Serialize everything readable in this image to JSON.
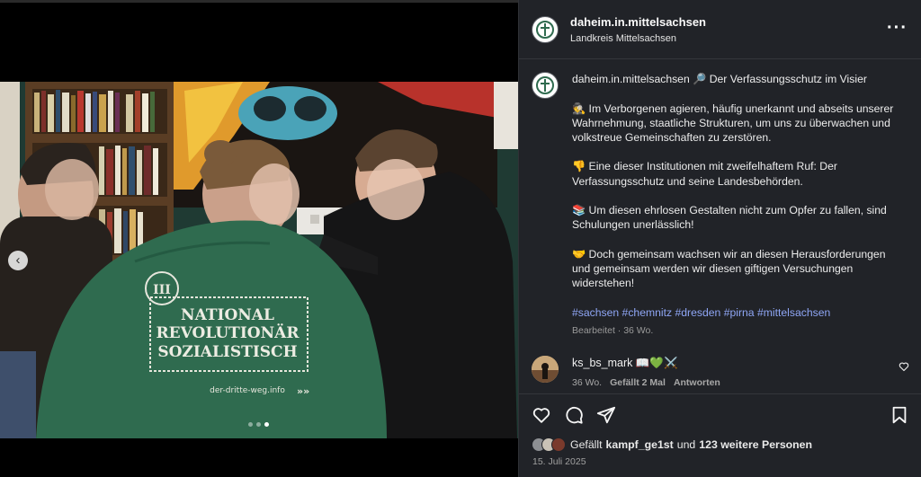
{
  "header": {
    "username": "daheim.in.mittelsachsen",
    "location": "Landkreis Mittelsachsen",
    "more_icon": "more-horizontal-icon"
  },
  "caption": {
    "owner": "daheim.in.mittelsachsen",
    "title_line": "🔎 Der Verfassungsschutz im Visier",
    "paragraphs": [
      "🕵️ Im Verborgenen agieren, häufig unerkannt und abseits unserer Wahrnehmung, staatliche Strukturen, um uns zu überwachen und volkstreue Gemeinschaften zu zerstören.",
      "👎 Eine dieser Institutionen mit zweifelhaftem Ruf: Der Verfassungsschutz und seine Landesbehörden.",
      "📚 Um diesen ehrlosen Gestalten nicht zum Opfer zu fallen, sind Schulungen unerlässlich!",
      "🤝 Doch gemeinsam wachsen wir an diesen Herausforderungen und gemeinsam werden wir diesen giftigen Versuchungen widerstehen!"
    ],
    "hashtags": "#sachsen #chemnitz #dresden #pirna #mittelsachsen",
    "edited": "Bearbeitet · 36 Wo."
  },
  "comment": {
    "username": "ks_bs_mark 📖💚⚔️",
    "age": "36 Wo.",
    "likes": "Gefällt 2 Mal",
    "reply": "Antworten"
  },
  "actions": {
    "like_icon": "heart-icon",
    "comment_icon": "comment-icon",
    "share_icon": "share-icon",
    "save_icon": "bookmark-icon"
  },
  "likes": {
    "prefix": "Gefällt",
    "first_user": "kampf_ge1st",
    "connector": "und",
    "others": "123 weitere Personen"
  },
  "date": "15. Juli 2025",
  "photo": {
    "hoodie_numeral": "III",
    "hoodie_lines": [
      "NATIONAL",
      "REVOLUTIONÄR",
      "SOZIALISTISCH"
    ],
    "hoodie_url": "der-dritte-weg.info",
    "slide_index": 3,
    "slide_count": 3
  },
  "colors": {
    "panel_bg": "#212328",
    "hashtag": "#8fa6f5",
    "hoodie_green": "#2f6b4f"
  }
}
